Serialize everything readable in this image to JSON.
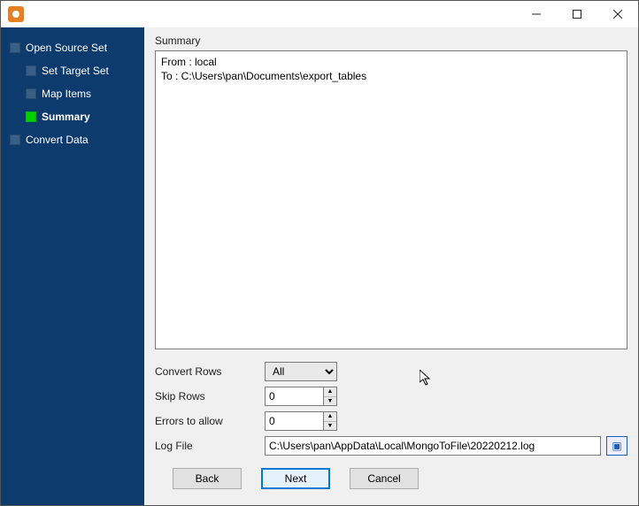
{
  "sidebar": {
    "items": [
      {
        "label": "Open Source Set",
        "child": false,
        "active": false
      },
      {
        "label": "Set Target Set",
        "child": true,
        "active": false
      },
      {
        "label": "Map Items",
        "child": true,
        "active": false
      },
      {
        "label": "Summary",
        "child": true,
        "active": true
      },
      {
        "label": "Convert Data",
        "child": false,
        "active": false
      }
    ]
  },
  "main": {
    "section_title": "Summary",
    "summary_text": "From : local\nTo : C:\\Users\\pan\\Documents\\export_tables",
    "form": {
      "convert_rows": {
        "label": "Convert Rows",
        "value": "All"
      },
      "skip_rows": {
        "label": "Skip Rows",
        "value": "0"
      },
      "errors": {
        "label": "Errors to allow",
        "value": "0"
      },
      "log_file": {
        "label": "Log File",
        "value": "C:\\Users\\pan\\AppData\\Local\\MongoToFile\\20220212.log"
      }
    }
  },
  "buttons": {
    "back": "Back",
    "next": "Next",
    "cancel": "Cancel"
  }
}
